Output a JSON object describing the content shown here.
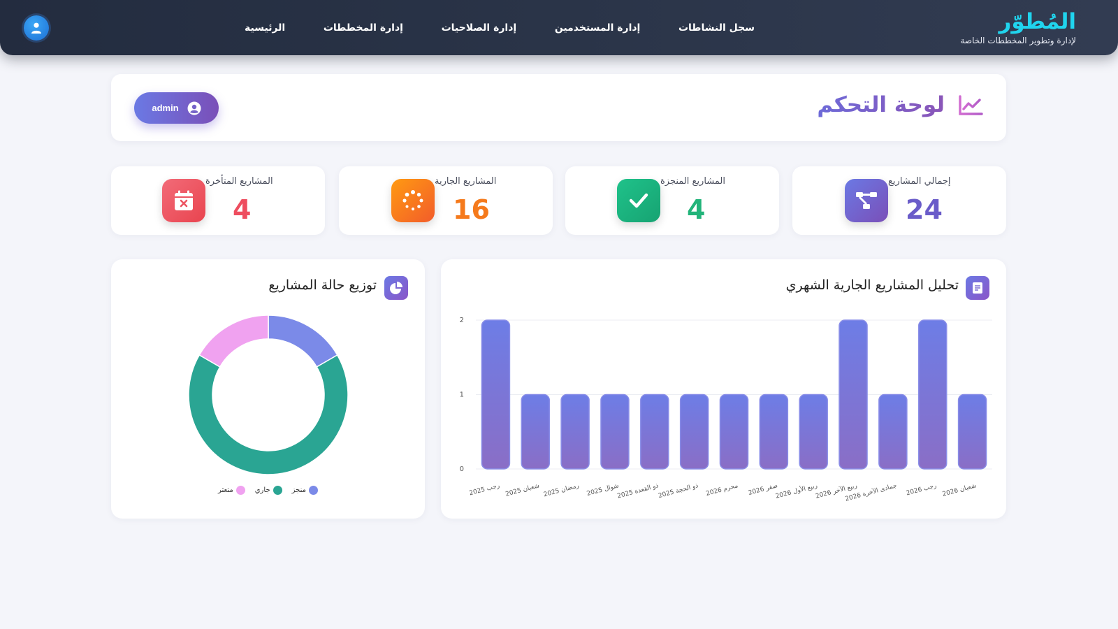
{
  "brand": {
    "title": "المُطوّر",
    "subtitle": "لإدارة وتطوير المخططات الخاصة"
  },
  "nav": {
    "items": [
      {
        "label": "الرئيسية"
      },
      {
        "label": "إدارة المخططات"
      },
      {
        "label": "إدارة الصلاحيات"
      },
      {
        "label": "إدارة المستخدمين"
      },
      {
        "label": "سجل النشاطات"
      }
    ],
    "avatar_icon": "user-icon"
  },
  "header": {
    "title": "لوحة التحكم",
    "title_icon": "chart-line-icon",
    "user": "admin",
    "user_icon": "user-circle-icon"
  },
  "stats": [
    {
      "label": "إجمالي المشاريع",
      "value": "24",
      "icon": "project-diagram-icon",
      "color": "#6a5cc9"
    },
    {
      "label": "المشاريع المنجزة",
      "value": "4",
      "icon": "check-icon",
      "color": "#22b47a"
    },
    {
      "label": "المشاريع الجارية",
      "value": "16",
      "icon": "spinner-icon",
      "color": "#f57a1c"
    },
    {
      "label": "المشاريع المتأخرة",
      "value": "4",
      "icon": "calendar-times-icon",
      "color": "#ee4d5f"
    }
  ],
  "bar_card": {
    "title": "تحليل المشاريع الجارية الشهري",
    "icon": "file-chart-icon"
  },
  "donut_card": {
    "title": "توزيع حالة المشاريع",
    "icon": "chart-pie-icon"
  },
  "chart_data": [
    {
      "type": "bar",
      "title": "تحليل المشاريع الجارية الشهري",
      "categories": [
        "رجب 2025",
        "شعبان 2025",
        "رمضان 2025",
        "شوال 2025",
        "ذو القعدة 2025",
        "ذو الحجة 2025",
        "محرم 2026",
        "صفر 2026",
        "ربيع الأول 2026",
        "ربيع الآخر 2026",
        "جمادى الآخرة 2026",
        "رجب 2026",
        "شعبان 2026"
      ],
      "values": [
        2,
        1,
        1,
        1,
        1,
        1,
        1,
        1,
        1,
        2,
        1,
        2,
        1
      ],
      "ylim": [
        0,
        2
      ],
      "yticks": [
        0,
        1,
        2
      ],
      "color": "#7a72d4",
      "grid": true
    },
    {
      "type": "pie",
      "title": "توزيع حالة المشاريع",
      "labels": [
        "منجز",
        "جاري",
        "متعثر"
      ],
      "values": [
        4,
        16,
        4
      ],
      "colors": [
        "#7b8ae8",
        "#2aa593",
        "#f0a2f0"
      ],
      "legend": "bottom"
    }
  ]
}
